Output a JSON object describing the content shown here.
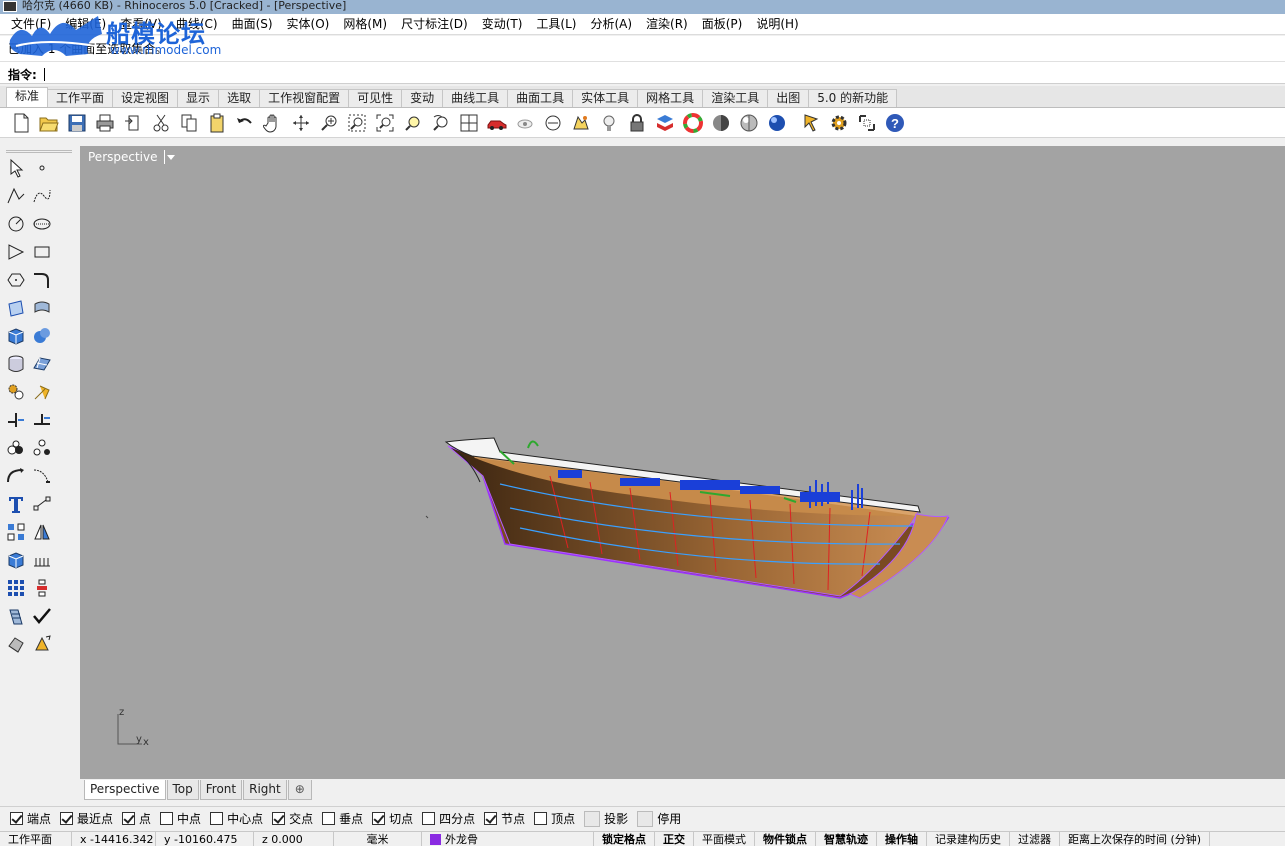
{
  "window": {
    "title": "哈尔克 (4660 KB) - Rhinoceros 5.0 [Cracked] - [Perspective]"
  },
  "menu": [
    "文件(F)",
    "编辑(E)",
    "查看(V)",
    "曲线(C)",
    "曲面(S)",
    "实体(O)",
    "网格(M)",
    "尺寸标注(D)",
    "变动(T)",
    "工具(L)",
    "分析(A)",
    "渲染(R)",
    "面板(P)",
    "说明(H)"
  ],
  "watermark": {
    "name": "船模论坛",
    "url": "www.rhmodel.com"
  },
  "command": {
    "history": "已加入 1 个曲面至选取集合。",
    "prompt_label": "指令:",
    "input_value": ""
  },
  "toolbar_tabs": [
    "标准",
    "工作平面",
    "设定视图",
    "显示",
    "选取",
    "工作视窗配置",
    "可见性",
    "变动",
    "曲线工具",
    "曲面工具",
    "实体工具",
    "网格工具",
    "渲染工具",
    "出图",
    "5.0 的新功能"
  ],
  "active_toolbar_tab": "标准",
  "standard_toolbar_icons": [
    "new-document-icon",
    "open-folder-icon",
    "save-icon",
    "print-icon",
    "import-icon",
    "cut-icon",
    "copy-icon",
    "paste-icon",
    "undo-icon",
    "pan-hand-icon",
    "rotate-view-icon",
    "zoom-dynamic-icon",
    "zoom-window-icon",
    "zoom-extents-icon",
    "zoom-selected-icon",
    "undo-view-icon",
    "four-viewports-icon",
    "car-icon",
    "hide-icon",
    "show-icon",
    "lock-layer-icon",
    "light-bulb-icon",
    "lock-icon",
    "layer-icon",
    "color-wheel-icon",
    "shaded-sphere-icon",
    "rendered-sphere-icon",
    "blue-sphere-icon",
    "osnap-icon",
    "options-gear-icon",
    "grid-snap-icon",
    "help-icon"
  ],
  "left_tools": [
    "select-icon",
    "point-icon",
    "polyline-icon",
    "curve-icon",
    "circle-icon",
    "ellipse-icon",
    "arc-icon",
    "rectangle-icon",
    "polygon-icon",
    "fillet-icon",
    "surface-corners-icon",
    "extrude-curve-icon",
    "box-icon",
    "boolean-union-icon",
    "cylinder-icon",
    "mesh-plane-icon",
    "explode-icon",
    "trim-icon",
    "split-icon",
    "join-icon",
    "group-icon",
    "ungroup-icon",
    "offset-icon",
    "blend-icon",
    "text-icon",
    "dimension-icon",
    "array-icon",
    "mirror-icon",
    "block-icon",
    "hatch-icon",
    "grid-array-icon",
    "align-icon",
    "bend-icon",
    "check-icon",
    "solid-tools-icon",
    "render-mesh-icon"
  ],
  "viewport": {
    "name": "Perspective",
    "axis_z": "z",
    "axis_y": "y",
    "axis_x": "x"
  },
  "viewport_tabs": [
    "Perspective",
    "Top",
    "Front",
    "Right"
  ],
  "active_viewport_tab": "Perspective",
  "add_tab_symbol": "⊕",
  "osnaps": [
    {
      "label": "端点",
      "checked": true
    },
    {
      "label": "最近点",
      "checked": true
    },
    {
      "label": "点",
      "checked": true
    },
    {
      "label": "中点",
      "checked": false
    },
    {
      "label": "中心点",
      "checked": false
    },
    {
      "label": "交点",
      "checked": true
    },
    {
      "label": "垂点",
      "checked": false
    },
    {
      "label": "切点",
      "checked": true
    },
    {
      "label": "四分点",
      "checked": false
    },
    {
      "label": "节点",
      "checked": true
    },
    {
      "label": "顶点",
      "checked": false
    }
  ],
  "osnap_extra": {
    "projection": "投影",
    "disable": "停用"
  },
  "statusbar": {
    "cplane": "工作平面",
    "x": "x -14416.342",
    "y": "y -10160.475",
    "z": "z 0.000",
    "units": "毫米",
    "layer": "外龙骨",
    "layer_color": "#8a2be2",
    "grid_snap": "锁定格点",
    "ortho": "正交",
    "planar": "平面模式",
    "osnap": "物件锁点",
    "smarttrack": "智慧轨迹",
    "gumball": "操作轴",
    "history": "记录建构历史",
    "filter": "过滤器",
    "autosave": "距离上次保存的时间 (分钟)"
  }
}
